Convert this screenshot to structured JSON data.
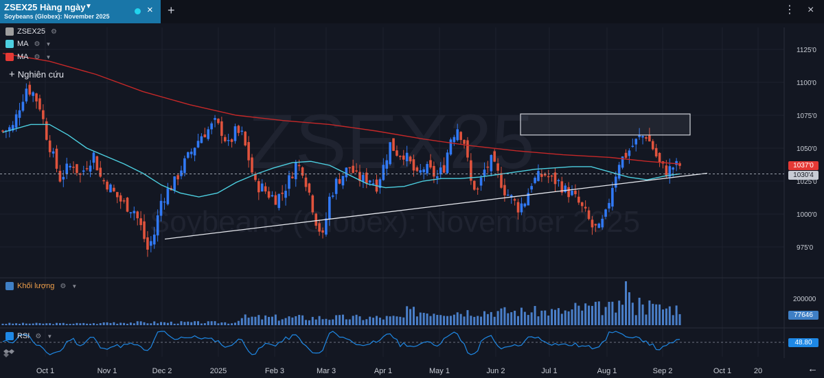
{
  "tab": {
    "title": "ZSEX25 Hàng ngày",
    "subtitle": "Soybeans (Globex): November 2025",
    "caret_icon": "chevron-down-icon",
    "status_icon": "live-dot-icon",
    "close_icon": "close-icon",
    "add_icon": "plus-icon"
  },
  "window": {
    "more_icon": "more-vertical-icon",
    "close_icon": "close-icon",
    "back_icon": "back-arrow-icon"
  },
  "legend": [
    {
      "label": "ZSEX25",
      "color": "#9e9e9e"
    },
    {
      "label": "MA",
      "color": "#4dd0e1"
    },
    {
      "label": "MA",
      "color": "#e53935"
    }
  ],
  "studies_label": "Nghiên cứu",
  "watermark": {
    "symbol": "ZSEX25",
    "name": "Soybeans (Globex): November 2025"
  },
  "colors": {
    "background": "#131722",
    "up": "#3179f5",
    "down": "#e0533d",
    "ma_fast": "#4dd0e1",
    "ma_slow": "#c62828",
    "volume": "#4a7fc9",
    "rsi": "#1e88e5",
    "accent": "#1976a8"
  },
  "chart_data": [
    {
      "type": "candlestick",
      "title": "ZSEX25 Hàng ngày",
      "y_ticks": [
        "1125'0",
        "1100'0",
        "1075'0",
        "1050'0",
        "1025'0",
        "1000'0",
        "975'0"
      ],
      "y_values": [
        1125,
        1100,
        1075,
        1050,
        1025,
        1000,
        975
      ],
      "ylim": [
        955,
        1137
      ],
      "last_price_label": "1037'0",
      "last_price": 1037,
      "ma_fast_label": "1030'4",
      "ma_fast_last": 1030.5,
      "ma_slow_last": 1038,
      "ma_fast": [
        [
          0,
          1062
        ],
        [
          6,
          1068
        ],
        [
          10,
          1068
        ],
        [
          14,
          1060
        ],
        [
          18,
          1050
        ],
        [
          22,
          1044
        ],
        [
          26,
          1038
        ],
        [
          30,
          1031
        ],
        [
          34,
          1022
        ],
        [
          38,
          1016
        ],
        [
          42,
          1013
        ],
        [
          46,
          1016
        ],
        [
          50,
          1024
        ],
        [
          54,
          1030
        ],
        [
          58,
          1035
        ],
        [
          62,
          1039
        ],
        [
          66,
          1040
        ],
        [
          70,
          1037
        ],
        [
          74,
          1030
        ],
        [
          78,
          1023
        ],
        [
          82,
          1020
        ],
        [
          86,
          1021
        ],
        [
          90,
          1025
        ],
        [
          94,
          1027
        ],
        [
          98,
          1027
        ],
        [
          102,
          1028
        ],
        [
          106,
          1030
        ],
        [
          110,
          1032
        ],
        [
          114,
          1034
        ],
        [
          118,
          1035
        ],
        [
          122,
          1036
        ],
        [
          126,
          1036
        ],
        [
          130,
          1032
        ],
        [
          134,
          1028
        ],
        [
          138,
          1026
        ],
        [
          142,
          1029
        ],
        [
          145,
          1030.5
        ]
      ],
      "ma_slow": [
        [
          0,
          1122
        ],
        [
          10,
          1116
        ],
        [
          20,
          1106
        ],
        [
          30,
          1093
        ],
        [
          40,
          1083
        ],
        [
          50,
          1075
        ],
        [
          60,
          1071
        ],
        [
          70,
          1068
        ],
        [
          80,
          1063
        ],
        [
          90,
          1057
        ],
        [
          100,
          1052
        ],
        [
          110,
          1048
        ],
        [
          120,
          1045
        ],
        [
          130,
          1043
        ],
        [
          138,
          1040
        ],
        [
          145,
          1038
        ]
      ],
      "close": [
        [
          0,
          1063
        ],
        [
          3,
          1066
        ],
        [
          5,
          1082
        ],
        [
          7,
          1096
        ],
        [
          9,
          1092
        ],
        [
          11,
          1082
        ],
        [
          13,
          1060
        ],
        [
          15,
          1043
        ],
        [
          17,
          1027
        ],
        [
          19,
          1034
        ],
        [
          21,
          1038
        ],
        [
          23,
          1029
        ],
        [
          25,
          1038
        ],
        [
          27,
          1045
        ],
        [
          29,
          1028
        ],
        [
          31,
          1023
        ],
        [
          33,
          1016
        ],
        [
          35,
          1010
        ],
        [
          37,
          1006
        ],
        [
          39,
          1003
        ],
        [
          41,
          990
        ],
        [
          43,
          973
        ],
        [
          45,
          985
        ],
        [
          47,
          1010
        ],
        [
          49,
          1018
        ],
        [
          51,
          1024
        ],
        [
          53,
          1035
        ],
        [
          55,
          1043
        ],
        [
          57,
          1052
        ],
        [
          59,
          1060
        ],
        [
          61,
          1064
        ],
        [
          63,
          1069
        ],
        [
          65,
          1063
        ],
        [
          67,
          1052
        ],
        [
          69,
          1062
        ],
        [
          71,
          1060
        ],
        [
          73,
          1042
        ],
        [
          75,
          1022
        ],
        [
          77,
          1020
        ],
        [
          79,
          1015
        ],
        [
          81,
          1012
        ],
        [
          83,
          1016
        ],
        [
          85,
          1026
        ],
        [
          87,
          1038
        ],
        [
          89,
          1034
        ],
        [
          91,
          1016
        ],
        [
          93,
          995
        ],
        [
          95,
          982
        ],
        [
          97,
          1012
        ],
        [
          99,
          1024
        ],
        [
          101,
          1030
        ],
        [
          103,
          1036
        ],
        [
          105,
          1028
        ],
        [
          107,
          1026
        ],
        [
          109,
          1027
        ],
        [
          111,
          1022
        ],
        [
          113,
          1036
        ],
        [
          115,
          1053
        ],
        [
          117,
          1047
        ],
        [
          119,
          1046
        ],
        [
          121,
          1038
        ],
        [
          123,
          1028
        ],
        [
          125,
          1035
        ],
        [
          127,
          1032
        ],
        [
          129,
          1028
        ],
        [
          131,
          1036
        ],
        [
          133,
          1058
        ],
        [
          135,
          1066
        ],
        [
          137,
          1055
        ],
        [
          139,
          1024
        ],
        [
          141,
          1018
        ],
        [
          143,
          1033
        ],
        [
          145,
          1040
        ],
        [
          147,
          1030
        ],
        [
          149,
          1018
        ],
        [
          151,
          1012
        ],
        [
          153,
          1005
        ],
        [
          155,
          1010
        ],
        [
          157,
          1024
        ],
        [
          159,
          1028
        ],
        [
          161,
          1030
        ],
        [
          163,
          1026
        ],
        [
          165,
          1024
        ],
        [
          167,
          1018
        ],
        [
          169,
          1015
        ],
        [
          171,
          1008
        ],
        [
          173,
          1000
        ],
        [
          175,
          990
        ],
        [
          177,
          988
        ],
        [
          179,
          999
        ],
        [
          181,
          1022
        ],
        [
          183,
          1040
        ],
        [
          185,
          1045
        ],
        [
          187,
          1052
        ],
        [
          189,
          1058
        ],
        [
          191,
          1060
        ],
        [
          193,
          1050
        ],
        [
          195,
          1038
        ],
        [
          197,
          1032
        ],
        [
          199,
          1036
        ],
        [
          201,
          1037
        ]
      ],
      "box_zone": [
        1060,
        1076
      ],
      "trendline": [
        [
          981,
          972
        ],
        [
          1031,
          985
        ]
      ],
      "x_labels": [
        "Oct 1",
        "Nov 1",
        "Dec 2",
        "2025",
        "Feb 3",
        "Mar 3",
        "Apr 1",
        "May 1",
        "Jun 2",
        "Jul 1",
        "Aug 1",
        "Sep 2",
        "Oct 1",
        "20"
      ]
    },
    {
      "type": "bar",
      "title": "Khối lượng",
      "y_ticks": [
        "200000"
      ],
      "y_values": [
        200000
      ],
      "last_value_label": "77646",
      "last_value": 77646
    },
    {
      "type": "line",
      "title": "RSI",
      "last_value_label": "48.80",
      "last_value": 48.8
    }
  ]
}
